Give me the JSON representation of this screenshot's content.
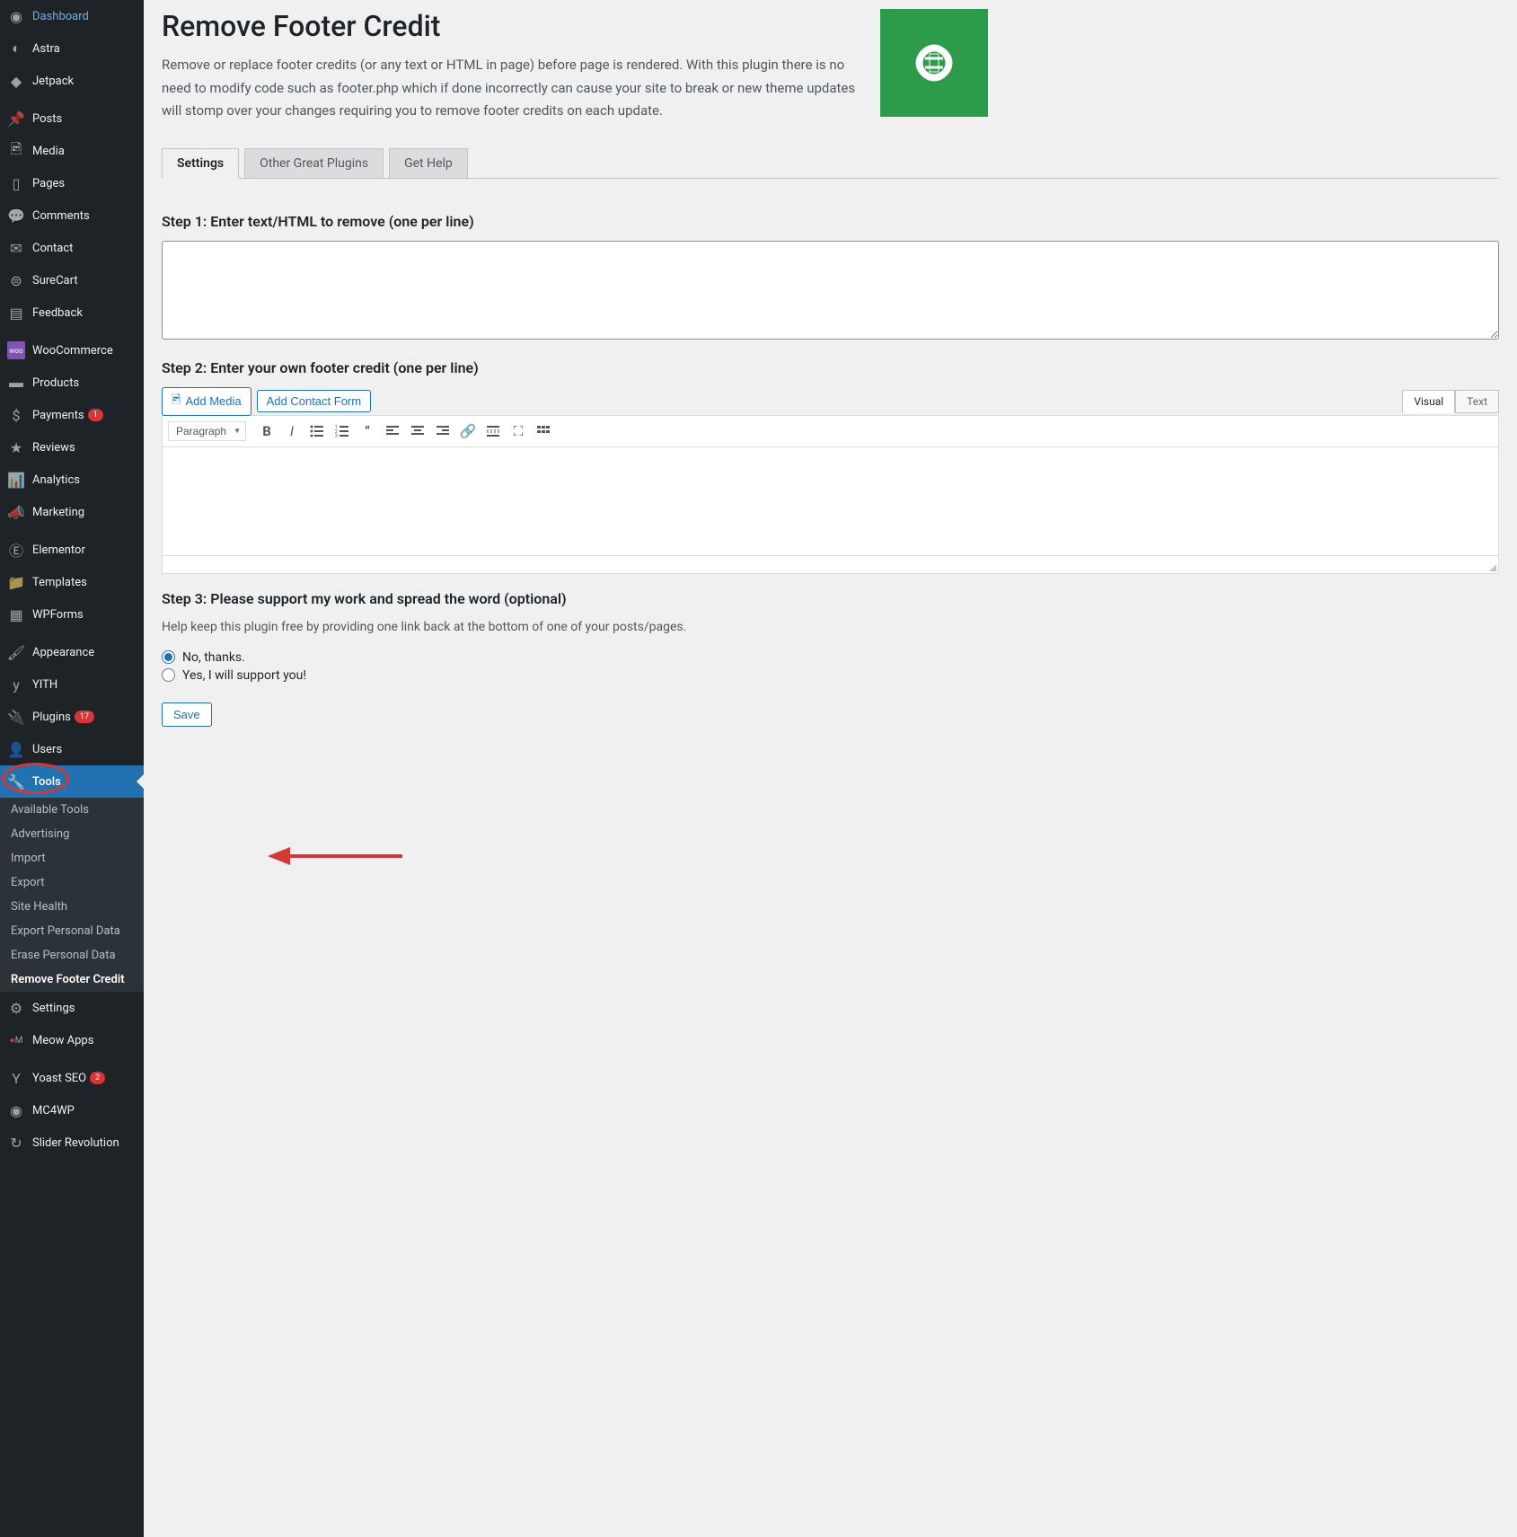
{
  "sidebar": {
    "dashboard": "Dashboard",
    "astra": "Astra",
    "jetpack": "Jetpack",
    "posts": "Posts",
    "media": "Media",
    "pages": "Pages",
    "comments": "Comments",
    "contact": "Contact",
    "surecart": "SureCart",
    "feedback": "Feedback",
    "woocommerce": "WooCommerce",
    "products": "Products",
    "payments": "Payments",
    "payments_badge": "1",
    "reviews": "Reviews",
    "analytics": "Analytics",
    "marketing": "Marketing",
    "elementor": "Elementor",
    "templates": "Templates",
    "wpforms": "WPForms",
    "appearance": "Appearance",
    "yith": "YITH",
    "plugins": "Plugins",
    "plugins_badge": "17",
    "users": "Users",
    "tools": "Tools",
    "settings": "Settings",
    "meow": "Meow Apps",
    "yoast": "Yoast SEO",
    "yoast_badge": "2",
    "mc4wp": "MC4WP",
    "slider_rev": "Slider Revolution"
  },
  "submenu": {
    "available_tools": "Available Tools",
    "advertising": "Advertising",
    "import": "Import",
    "export": "Export",
    "site_health": "Site Health",
    "export_personal": "Export Personal Data",
    "erase_personal": "Erase Personal Data",
    "remove_footer": "Remove Footer Credit"
  },
  "page": {
    "title": "Remove Footer Credit",
    "description": "Remove or replace footer credits (or any text or HTML in page) before page is rendered. With this plugin there is no need to modify code such as footer.php which if done incorrectly can cause your site to break or new theme updates will stomp over your changes requiring you to remove footer credits on each update."
  },
  "tabs": {
    "settings": "Settings",
    "other": "Other Great Plugins",
    "help": "Get Help"
  },
  "step1_label": "Step 1: Enter text/HTML to remove (one per line)",
  "step2_label": "Step 2: Enter your own footer credit (one per line)",
  "step3_label": "Step 3: Please support my work and spread the word (optional)",
  "editor": {
    "add_media": "Add Media",
    "add_contact": "Add Contact Form",
    "visual": "Visual",
    "text": "Text",
    "format": "Paragraph"
  },
  "support_text": "Help keep this plugin free by providing one link back at the bottom of one of your posts/pages.",
  "radio_no": "No, thanks.",
  "radio_yes": "Yes, I will support you!",
  "save": "Save"
}
